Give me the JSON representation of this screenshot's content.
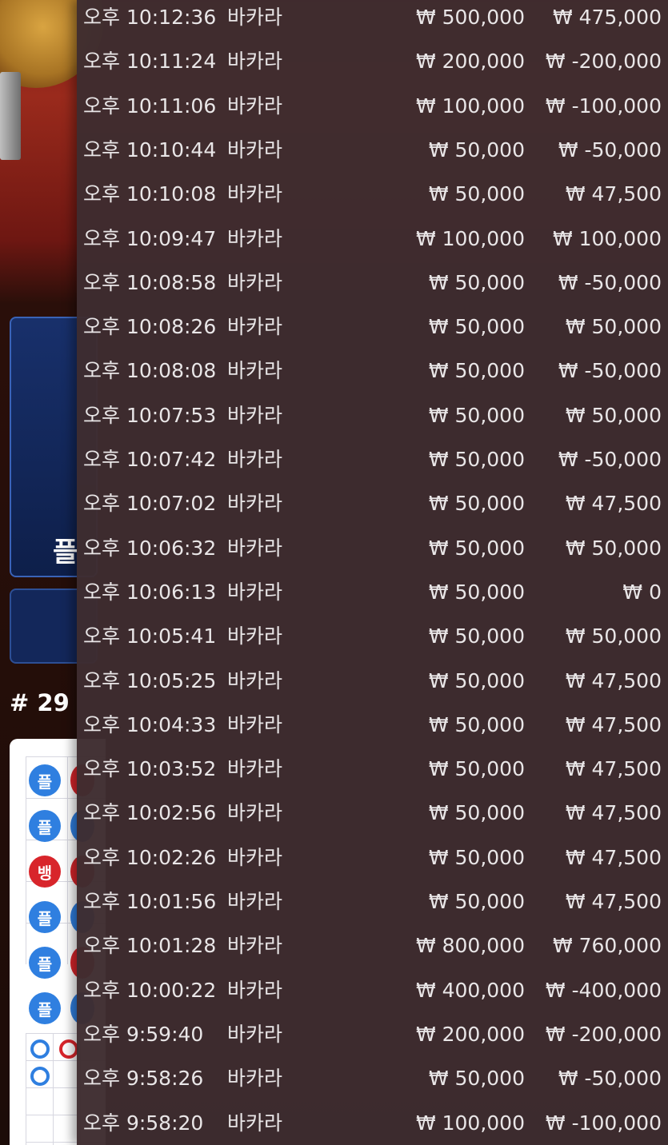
{
  "background_game": {
    "bet_area_label": "플",
    "round_label": "# 29",
    "road_beads": [
      {
        "label": "플",
        "color": "blue"
      },
      {
        "label": "플",
        "color": "blue"
      },
      {
        "label": "뱅",
        "color": "red"
      },
      {
        "label": "플",
        "color": "blue"
      },
      {
        "label": "플",
        "color": "blue"
      },
      {
        "label": "플",
        "color": "blue"
      }
    ]
  },
  "history": {
    "rows": [
      {
        "time": "오후 10:12:36",
        "game": "바카라",
        "bet": "₩ 500,000",
        "result": "₩ 475,000"
      },
      {
        "time": "오후 10:11:24",
        "game": "바카라",
        "bet": "₩ 200,000",
        "result": "₩ -200,000"
      },
      {
        "time": "오후 10:11:06",
        "game": "바카라",
        "bet": "₩ 100,000",
        "result": "₩ -100,000"
      },
      {
        "time": "오후 10:10:44",
        "game": "바카라",
        "bet": "₩ 50,000",
        "result": "₩ -50,000"
      },
      {
        "time": "오후 10:10:08",
        "game": "바카라",
        "bet": "₩ 50,000",
        "result": "₩ 47,500"
      },
      {
        "time": "오후 10:09:47",
        "game": "바카라",
        "bet": "₩ 100,000",
        "result": "₩ 100,000"
      },
      {
        "time": "오후 10:08:58",
        "game": "바카라",
        "bet": "₩ 50,000",
        "result": "₩ -50,000"
      },
      {
        "time": "오후 10:08:26",
        "game": "바카라",
        "bet": "₩ 50,000",
        "result": "₩ 50,000"
      },
      {
        "time": "오후 10:08:08",
        "game": "바카라",
        "bet": "₩ 50,000",
        "result": "₩ -50,000"
      },
      {
        "time": "오후 10:07:53",
        "game": "바카라",
        "bet": "₩ 50,000",
        "result": "₩ 50,000"
      },
      {
        "time": "오후 10:07:42",
        "game": "바카라",
        "bet": "₩ 50,000",
        "result": "₩ -50,000"
      },
      {
        "time": "오후 10:07:02",
        "game": "바카라",
        "bet": "₩ 50,000",
        "result": "₩ 47,500"
      },
      {
        "time": "오후 10:06:32",
        "game": "바카라",
        "bet": "₩ 50,000",
        "result": "₩ 50,000"
      },
      {
        "time": "오후 10:06:13",
        "game": "바카라",
        "bet": "₩ 50,000",
        "result": "₩ 0"
      },
      {
        "time": "오후 10:05:41",
        "game": "바카라",
        "bet": "₩ 50,000",
        "result": "₩ 50,000"
      },
      {
        "time": "오후 10:05:25",
        "game": "바카라",
        "bet": "₩ 50,000",
        "result": "₩ 47,500"
      },
      {
        "time": "오후 10:04:33",
        "game": "바카라",
        "bet": "₩ 50,000",
        "result": "₩ 47,500"
      },
      {
        "time": "오후 10:03:52",
        "game": "바카라",
        "bet": "₩ 50,000",
        "result": "₩ 47,500"
      },
      {
        "time": "오후 10:02:56",
        "game": "바카라",
        "bet": "₩ 50,000",
        "result": "₩ 47,500"
      },
      {
        "time": "오후 10:02:26",
        "game": "바카라",
        "bet": "₩ 50,000",
        "result": "₩ 47,500"
      },
      {
        "time": "오후 10:01:56",
        "game": "바카라",
        "bet": "₩ 50,000",
        "result": "₩ 47,500"
      },
      {
        "time": "오후 10:01:28",
        "game": "바카라",
        "bet": "₩ 800,000",
        "result": "₩ 760,000"
      },
      {
        "time": "오후 10:00:22",
        "game": "바카라",
        "bet": "₩ 400,000",
        "result": "₩ -400,000"
      },
      {
        "time": "오후 9:59:40",
        "game": "바카라",
        "bet": "₩ 200,000",
        "result": "₩ -200,000"
      },
      {
        "time": "오후 9:58:26",
        "game": "바카라",
        "bet": "₩ 50,000",
        "result": "₩ -50,000"
      },
      {
        "time": "오후 9:58:20",
        "game": "바카라",
        "bet": "₩ 100,000",
        "result": "₩ -100,000"
      }
    ]
  },
  "colors": {
    "panel_bg": "#3e2c30",
    "text": "#e9e6e7",
    "player_blue": "#2f7fe0",
    "banker_red": "#d8252b"
  }
}
